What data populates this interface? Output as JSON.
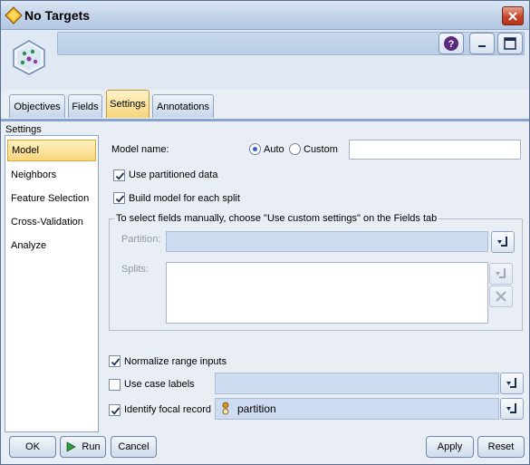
{
  "window": {
    "title": "No Targets",
    "close_icon": "close-icon"
  },
  "header": {
    "help_icon": "help-icon",
    "minimize_icon": "minimize-icon",
    "maximize_icon": "maximize-icon"
  },
  "tabs": [
    {
      "label": "Objectives"
    },
    {
      "label": "Fields"
    },
    {
      "label": "Settings"
    },
    {
      "label": "Annotations"
    }
  ],
  "settings_label": "Settings",
  "sidebar": {
    "items": [
      {
        "label": "Model"
      },
      {
        "label": "Neighbors"
      },
      {
        "label": "Feature Selection"
      },
      {
        "label": "Cross-Validation"
      },
      {
        "label": "Analyze"
      }
    ],
    "selected": "Model"
  },
  "model": {
    "model_name_label": "Model name:",
    "auto_label": "Auto",
    "custom_label": "Custom",
    "model_name_value": "",
    "use_partitioned_label": "Use partitioned data",
    "build_split_label": "Build model for each split",
    "group_title": "To select fields manually, choose \"Use custom settings\" on the Fields tab",
    "partition_label": "Partition:",
    "splits_label": "Splits:",
    "normalize_label": "Normalize range inputs",
    "case_labels_label": "Use case labels",
    "focal_label": "Identify focal record",
    "focal_value": "partition"
  },
  "footer": {
    "ok": "OK",
    "run": "Run",
    "cancel": "Cancel",
    "apply": "Apply",
    "reset": "Reset"
  },
  "colors": {
    "accent_selected": "#f7d57c",
    "window_bg": "#e9eef5",
    "tab_line": "#87a4cd"
  }
}
